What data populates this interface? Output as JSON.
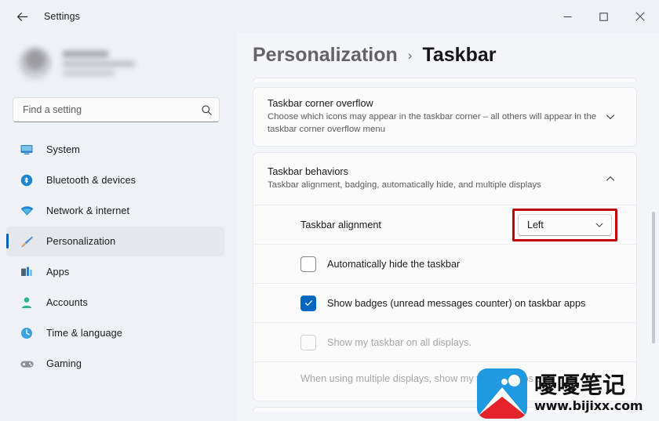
{
  "window": {
    "title": "Settings",
    "back_icon": "back-arrow-icon",
    "minimize_label": "Minimize",
    "maximize_label": "Maximize",
    "close_label": "Close"
  },
  "sidebar": {
    "search": {
      "placeholder": "Find a setting",
      "value": "",
      "icon": "search-icon"
    },
    "items": [
      {
        "label": "System",
        "icon": "monitor-icon",
        "selected": false
      },
      {
        "label": "Bluetooth & devices",
        "icon": "bluetooth-icon",
        "selected": false
      },
      {
        "label": "Network & internet",
        "icon": "wifi-icon",
        "selected": false
      },
      {
        "label": "Personalization",
        "icon": "paintbrush-icon",
        "selected": true
      },
      {
        "label": "Apps",
        "icon": "apps-icon",
        "selected": false
      },
      {
        "label": "Accounts",
        "icon": "account-icon",
        "selected": false
      },
      {
        "label": "Time & language",
        "icon": "clock-icon",
        "selected": false
      },
      {
        "label": "Gaming",
        "icon": "gamepad-icon",
        "selected": false
      }
    ]
  },
  "breadcrumb": {
    "parent": "Personalization",
    "separator": "›",
    "current": "Taskbar"
  },
  "main": {
    "cards": {
      "corner_overflow": {
        "title": "Taskbar corner overflow",
        "subtitle": "Choose which icons may appear in the taskbar corner – all others will appear in the taskbar corner overflow menu",
        "chevron": "chevron-down-icon",
        "expanded": false
      },
      "behaviors": {
        "title": "Taskbar behaviors",
        "subtitle": "Taskbar alignment, badging, automatically hide, and multiple displays",
        "chevron": "chevron-up-icon",
        "expanded": true,
        "alignment_row": {
          "label": "Taskbar alignment",
          "dropdown_value": "Left",
          "dropdown_icon": "chevron-down-icon",
          "highlight_color": "#c00000",
          "highlighted": true
        },
        "checkbox_rows": [
          {
            "label": "Automatically hide the taskbar",
            "checked": false,
            "disabled": false
          },
          {
            "label": "Show badges (unread messages counter) on taskbar apps",
            "checked": true,
            "disabled": false
          },
          {
            "label": "Show my taskbar on all displays.",
            "checked": false,
            "disabled": true
          }
        ],
        "multi_display_row": {
          "label": "When using multiple displays, show my taskbar apps on",
          "disabled": true
        }
      }
    }
  },
  "watermark": {
    "logo_icon": "mountain-logo-icon",
    "brand_cn": "嚘嚘笔记",
    "url": "www.bijixx.com",
    "logo_blue": "#1f9ae0",
    "logo_red": "#e4222c"
  },
  "theme": {
    "accent": "#005fb8",
    "checkbox_blue": "#0067c0"
  }
}
